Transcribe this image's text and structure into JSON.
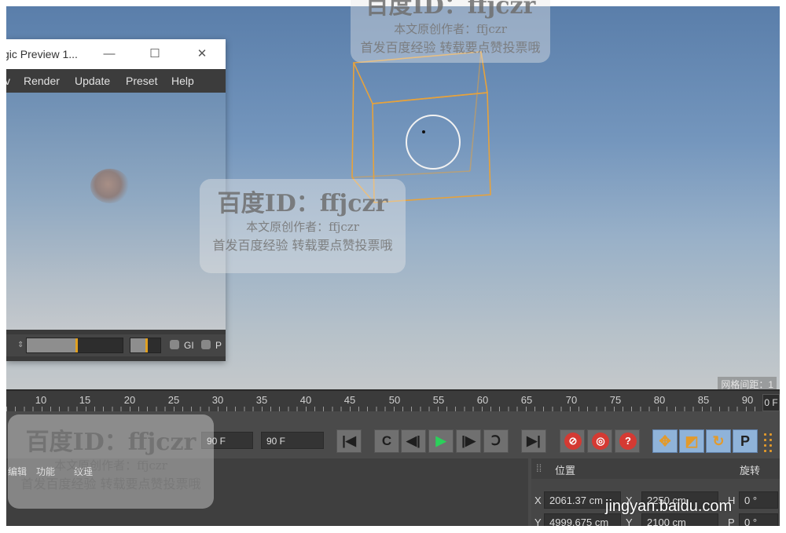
{
  "preview_window": {
    "title": "gic Preview 1...",
    "minimize": "—",
    "maximize": "☐",
    "close": "✕",
    "menu": [
      "v",
      "Render",
      "Update",
      "Preset",
      "Help"
    ],
    "toolbar": {
      "gi_label": "GI",
      "p_label": "P",
      "slider_progress": 0.51,
      "mini_progress": 0.5
    }
  },
  "viewport": {
    "grid_label": "网格间距：1"
  },
  "timeline": {
    "ticks": [
      "10",
      "15",
      "20",
      "25",
      "30",
      "35",
      "40",
      "45",
      "50",
      "55",
      "60",
      "65",
      "70",
      "75",
      "80",
      "85",
      "90"
    ],
    "frame_box": "0 F"
  },
  "transport": {
    "start_field": "90 F",
    "end_field": "90 F",
    "buttons": {
      "goto_start": "|◀",
      "prev_key": "C",
      "prev_frame": "◀|",
      "play": "▶",
      "next_frame": "|▶",
      "next_key": "Ↄ",
      "goto_end": "▶|"
    },
    "record": {
      "rec1": "⊘",
      "rec2": "◎",
      "rec3": "?"
    },
    "modes": {
      "move": "✥",
      "scale": "◩",
      "rotate": "↻",
      "p": "P"
    }
  },
  "attributes": {
    "left_tabs": [
      "编辑",
      "功能",
      "纹理"
    ],
    "position_header": "位置",
    "rotation_header": "旋转",
    "x_label": "X",
    "y_label": "Y",
    "x_pos": "2061.37 cm",
    "y_pos": "4999.675 cm",
    "x_size": "2250 cm",
    "y_size": "2100 cm",
    "h_label": "H",
    "p_label": "P",
    "h_rot": "0 °",
    "p_rot": "0 °"
  },
  "watermarks": {
    "line1": "百度ID：ffjczr",
    "line2": "本文原创作者：ffjczr",
    "line3": "首发百度经验 转载要点赞投票哦"
  },
  "logo": "jingyan.baidu.com"
}
